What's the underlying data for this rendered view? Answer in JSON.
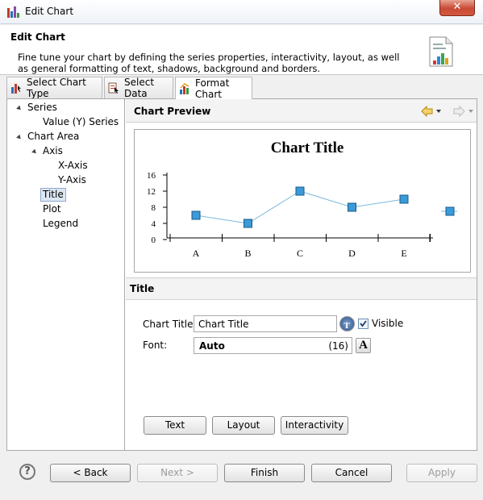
{
  "window": {
    "title": "Edit Chart",
    "close_symbol": "✕"
  },
  "header": {
    "title": "Edit Chart",
    "description": "Fine tune your chart by defining the series properties, interactivity, layout, as well as general formatting of text, shadows, background and borders."
  },
  "tabs": [
    {
      "label": "Select Chart Type",
      "icon": "chart-type-icon"
    },
    {
      "label": "Select Data",
      "icon": "select-data-icon"
    },
    {
      "label": "Format Chart",
      "icon": "format-chart-icon",
      "active": true
    }
  ],
  "tree": [
    {
      "label": "Series",
      "expanded": true
    },
    {
      "label": "Value (Y) Series"
    },
    {
      "label": "Chart Area",
      "expanded": true
    },
    {
      "label": "Axis",
      "expanded": true
    },
    {
      "label": "X-Axis"
    },
    {
      "label": "Y-Axis"
    },
    {
      "label": "Title",
      "selected": true
    },
    {
      "label": "Plot"
    },
    {
      "label": "Legend"
    }
  ],
  "preview": {
    "heading": "Chart Preview"
  },
  "chart_data": {
    "type": "line",
    "title": "Chart Title",
    "categories": [
      "A",
      "B",
      "C",
      "D",
      "E",
      ""
    ],
    "series": [
      {
        "values": [
          6,
          4,
          12,
          8,
          10,
          7
        ]
      }
    ],
    "yticks": [
      "16",
      "12",
      "8",
      "4",
      "0"
    ],
    "ylim": [
      0,
      16
    ],
    "grid": false,
    "marker": "square",
    "colors": {
      "line": "#7ab8dc",
      "marker": "#3b9ad8",
      "marker_edge": "#1a5a88"
    }
  },
  "section": {
    "title": "Title"
  },
  "form": {
    "chart_title_label": "Chart Title:",
    "chart_title_value": "Chart Title",
    "visible_label": "Visible",
    "visible_checked": true,
    "font_label": "Font:",
    "font_name": "Auto",
    "font_size": "(16)",
    "font_button": "A"
  },
  "sub_buttons": {
    "text": "Text",
    "layout": "Layout",
    "interactivity": "Interactivity"
  },
  "footer": {
    "help": "?",
    "back": "< Back",
    "next": "Next >",
    "finish": "Finish",
    "cancel": "Cancel",
    "apply": "Apply"
  }
}
